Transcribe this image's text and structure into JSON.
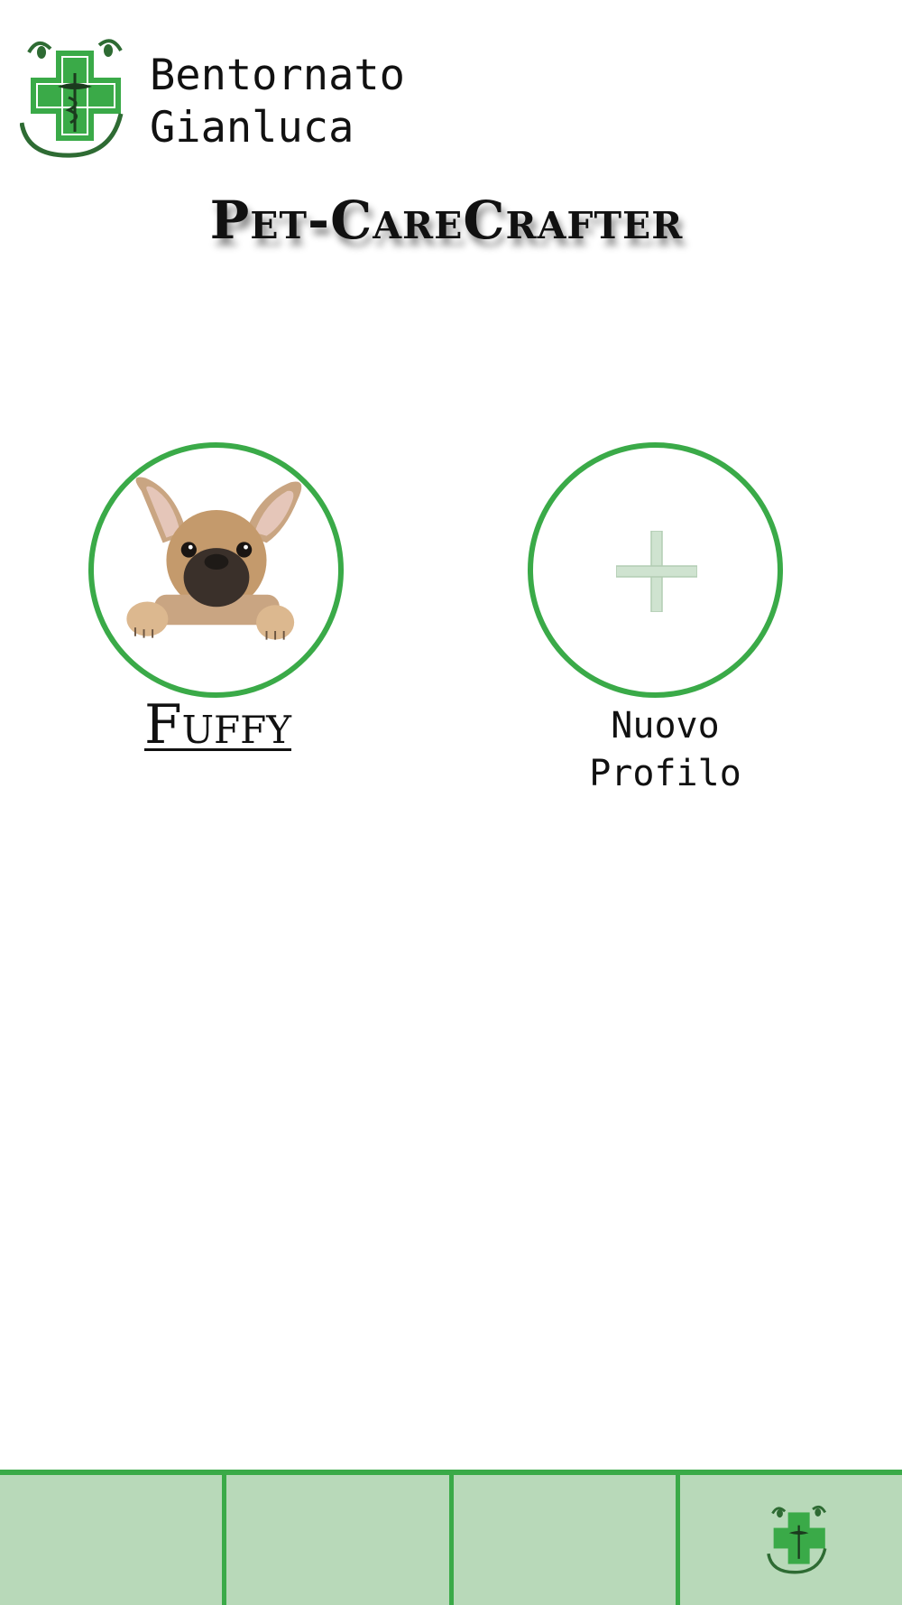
{
  "header": {
    "logo_icon": "smiling-pharmacy-cross-logo-icon",
    "greeting_line1": "Bentornato",
    "greeting_line2": "Gianluca"
  },
  "app_title": "Pet-CareCrafter",
  "profiles": [
    {
      "name": "Fuffy",
      "avatar": "french-bulldog-photo"
    },
    {
      "name_line1": "Nuovo",
      "name_line2": "Profilo",
      "icon": "plus-icon"
    }
  ],
  "bottom_nav": {
    "items": [
      "",
      "",
      "",
      ""
    ],
    "last_icon": "smiling-pharmacy-cross-logo-icon"
  },
  "colors": {
    "accent": "#3aaa48",
    "nav_background": "#b8d9b9",
    "plus_icon": "#cfe3d0"
  }
}
